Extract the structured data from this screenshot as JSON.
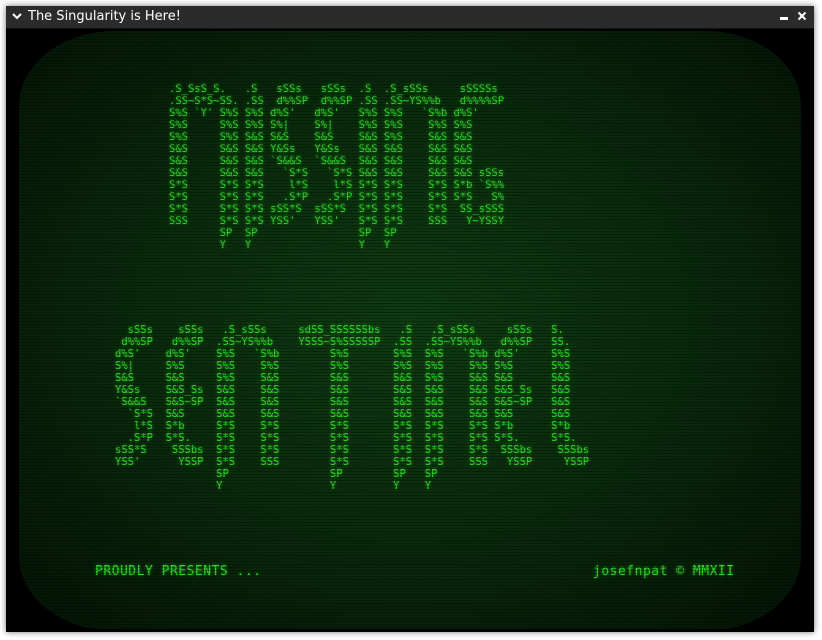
{
  "window": {
    "title": "The Singularity is Here!",
    "menu_icon": "chevron-down-icon",
    "minimize_glyph": "▄",
    "close_glyph": "✕"
  },
  "screen": {
    "ascii_title_line1": ".S_SsS_S.   .S   sSSs   sSSs  .S  .S_sSSs     sSSSSs\n.SS~S*S~SS. .SS  d%%SP  d%%SP .SS .SS~YS%%b   d%%%%SP\nS%S `Y' S%S S%S d%S'   d%S'   S%S S%S   `S%b d%S'\nS%S     S%S S%S S%|    S%|    S%S S%S    S%S S%S\nS%S     S%S S&S S&S    S&S    S&S S%S    S&S S&S\nS&S     S&S S&S Y&Ss   Y&Ss   S&S S&S    S&S S&S\nS&S     S&S S&S `S&&S  `S&&S  S&S S&S    S&S S&S\nS&S     S&S S&S   `S*S   `S*S S&S S&S    S&S S&S sSSs\nS*S     S*S S*S    l*S    l*S S*S S*S    S*S S*b `S%%\nS*S     S*S S*S   .S*P   .S*P S*S S*S    S*S S*S   S%\nS*S     S*S S*S sSS*S  sSS*S  S*S S*S    S*S  SS_sSSS\nSSS     S*S S*S YSS'   YSS'   S*S S*S    SSS   Y~YSSY\n        SP  SP                SP  SP\n        Y   Y                 Y   Y",
    "ascii_title_line2": "  sSSs    sSSs   .S_sSSs     sdSS_SSSSSSbs   .S   .S_sSSs     sSSs   S.\n d%%SP   d%%SP  .SS~YS%%b    YSSS~S%SSSSSP  .SS  .SS~YS%%b   d%%SP   SS.\nd%S'    d%S'    S%S   `S%b        S%S       S%S  S%S   `S%b d%S'     S%S\nS%|     S%S     S%S    S%S        S%S       S%S  S%S    S%S S%S      S%S\nS&S     S&S     S%S    S&S        S&S       S&S  S%S    S&S S&S      S&S\nY&Ss    S&S_Ss  S&S    S&S        S&S       S&S  S&S    S&S S&S_Ss   S&S\n`S&&S   S&S~SP  S&S    S&S        S&S       S&S  S&S    S&S S&S~SP   S&S\n  `S*S  S&S     S&S    S&S        S&S       S&S  S&S    S&S S&S      S&S\n   l*S  S*b     S*S    S*S        S*S       S*S  S*S    S*S S*b      S*b\n  .S*P  S*S.    S*S    S*S        S*S       S*S  S*S    S*S S*S.     S*S.\nsSS*S    SSSbs  S*S    S*S        S*S       S*S  S*S    S*S  SSSbs    SSSbs\nYSS'      YSSP  S*S    SSS        S*S       S*S  S*S    SSS   YSSP     YSSP\n                SP                SP        SP   SP\n                Y                 Y         Y    Y",
    "footer_left": "PROUDLY PRESENTS ...",
    "footer_right": "josefnpat © MMXII",
    "phosphor_color": "#33d82a"
  }
}
